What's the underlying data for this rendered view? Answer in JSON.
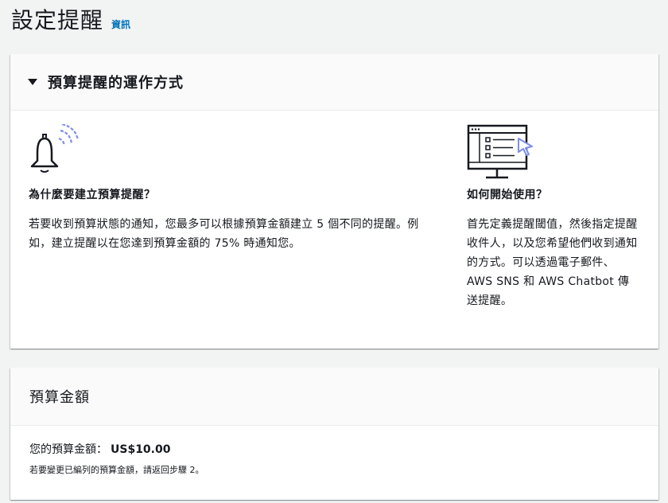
{
  "page": {
    "title": "設定提醒",
    "info_link": "資訊"
  },
  "how_it_works": {
    "title": "預算提醒的運作方式",
    "left": {
      "icon": "bell-icon",
      "heading": "為什麼要建立預算提醒？",
      "text": "若要收到預算狀態的通知，您最多可以根據預算金額建立 5 個不同的提醒。例如，建立提醒以在您達到預算金額的 75% 時通知您。"
    },
    "right": {
      "icon": "monitor-icon",
      "heading": "如何開始使用？",
      "text": "首先定義提醒閾值，然後指定提醒收件人，以及您希望他們收到通知的方式。可以透過電子郵件、AWS SNS 和 AWS Chatbot 傳送提醒。"
    }
  },
  "budget_amount": {
    "title": "預算金額",
    "label": "您的預算金額：",
    "value": "US$10.00",
    "note": "若要變更已編列的預算金額，請返回步驟 2。"
  },
  "colors": {
    "link": "#0073bb",
    "accent_icon": "#7d8ee8"
  }
}
